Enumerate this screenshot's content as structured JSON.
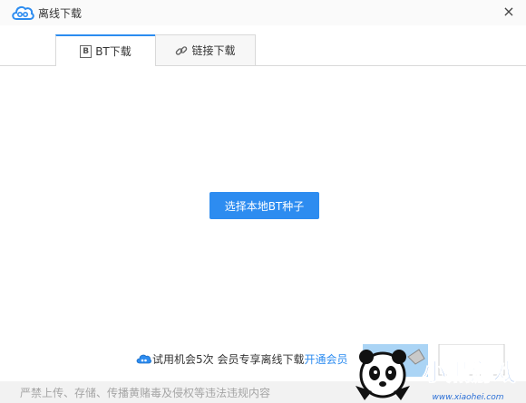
{
  "window": {
    "title": "离线下载",
    "logo_icon": "baidu-cloud-logo-icon",
    "close_icon": "×"
  },
  "tabs": [
    {
      "label": "BT下载",
      "icon": "bt-icon",
      "icon_text": "B",
      "active": true
    },
    {
      "label": "链接下载",
      "icon": "link-chain-icon",
      "active": false
    }
  ],
  "main": {
    "choose_button_label": "选择本地BT种子"
  },
  "trial": {
    "icon": "cloud-vip-icon",
    "text": "试用机会5次 会员专享离线下载",
    "link_label": "开通会员"
  },
  "footer": {
    "notice": "严禁上传、存储、传播黄赌毒及侵权等违法违规内容"
  },
  "watermark": {
    "brand": "小黑游戏",
    "url": "www.xiaohei.com"
  },
  "colors": {
    "accent": "#2d8cf0",
    "footer_bg": "#f2f2f2",
    "footer_text": "#a5a5a5"
  }
}
